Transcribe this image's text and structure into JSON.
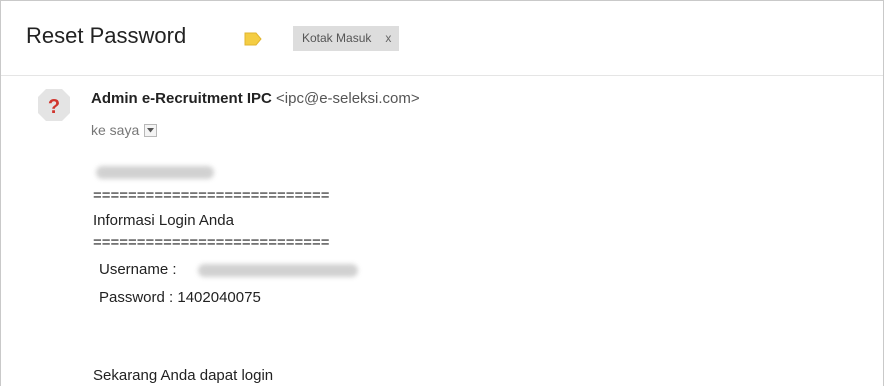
{
  "email": {
    "subject": "Reset Password",
    "label_chip": {
      "text": "Kotak Masuk",
      "close": "x"
    },
    "sender": {
      "name": "Admin e-Recruitment IPC",
      "email": "<ipc@e-seleksi.com>"
    },
    "recipient": "ke saya",
    "body": {
      "separator_top": "===========================",
      "heading": "Informasi Login Anda",
      "separator_bottom": "===========================",
      "username_label": "Username :",
      "password_label": "Password  :",
      "password_value": "1402040075",
      "closing_line": "Sekarang Anda dapat login"
    }
  },
  "colors": {
    "label_tag": "#f4cd43",
    "avatar_bg": "#e4e4e4",
    "avatar_question": "#d0352d",
    "chip_bg": "#dddddd"
  },
  "icons": {
    "label": "label-tag-icon",
    "avatar": "unknown-sender-avatar-icon",
    "dropdown": "chevron-down-icon"
  }
}
